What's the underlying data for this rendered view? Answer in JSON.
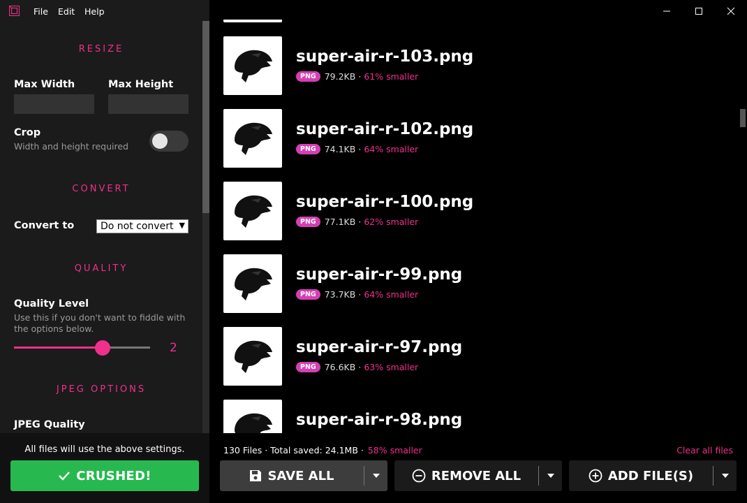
{
  "menu": {
    "items": [
      "File",
      "Edit",
      "Help"
    ]
  },
  "sidebar": {
    "resize": {
      "title": "RESIZE",
      "max_width_label": "Max Width",
      "max_height_label": "Max Height",
      "max_width_value": "",
      "max_height_value": "",
      "crop_label": "Crop",
      "crop_hint": "Width and height required",
      "crop_enabled": false
    },
    "convert": {
      "title": "CONVERT",
      "convert_to_label": "Convert to",
      "selected": "Do not convert"
    },
    "quality": {
      "title": "QUALITY",
      "level_label": "Quality Level",
      "hint": "Use this if you don't want to fiddle with the options below.",
      "value": "2",
      "fraction": 0.65
    },
    "jpeg": {
      "title": "JPEG OPTIONS",
      "quality_label": "JPEG Quality"
    },
    "footer": {
      "note": "All files will use the above settings.",
      "crush_label": "CRUSHED!"
    }
  },
  "files": [
    {
      "name": "super-air-r-103.png",
      "type": "PNG",
      "size": "79.2KB",
      "separator": "·",
      "savings": "61% smaller"
    },
    {
      "name": "super-air-r-102.png",
      "type": "PNG",
      "size": "74.1KB",
      "separator": "·",
      "savings": "64% smaller"
    },
    {
      "name": "super-air-r-100.png",
      "type": "PNG",
      "size": "77.1KB",
      "separator": "·",
      "savings": "62% smaller"
    },
    {
      "name": "super-air-r-99.png",
      "type": "PNG",
      "size": "73.7KB",
      "separator": "·",
      "savings": "64% smaller"
    },
    {
      "name": "super-air-r-97.png",
      "type": "PNG",
      "size": "76.6KB",
      "separator": "·",
      "savings": "63% smaller"
    },
    {
      "name": "super-air-r-98.png",
      "type": "PNG",
      "size": "",
      "separator": "",
      "savings": ""
    }
  ],
  "summary": {
    "text": "130 Files · Total saved: 24.1MB ·",
    "savings": "58% smaller",
    "clear_label": "Clear all files"
  },
  "actions": {
    "save_all": "SAVE ALL",
    "remove_all": "REMOVE ALL",
    "add_files": "ADD FILE(S)"
  },
  "colors": {
    "accent": "#f0308c",
    "badge": "#d63fb4",
    "success": "#27b94f",
    "sidebar_bg": "#1b1b1b",
    "main_bg": "#000000"
  },
  "icons": {
    "app": "app-logo-icon",
    "save": "floppy-disk-icon",
    "remove": "minus-circle-icon",
    "add": "plus-circle-icon",
    "caret": "caret-down-icon",
    "check": "check-icon"
  }
}
